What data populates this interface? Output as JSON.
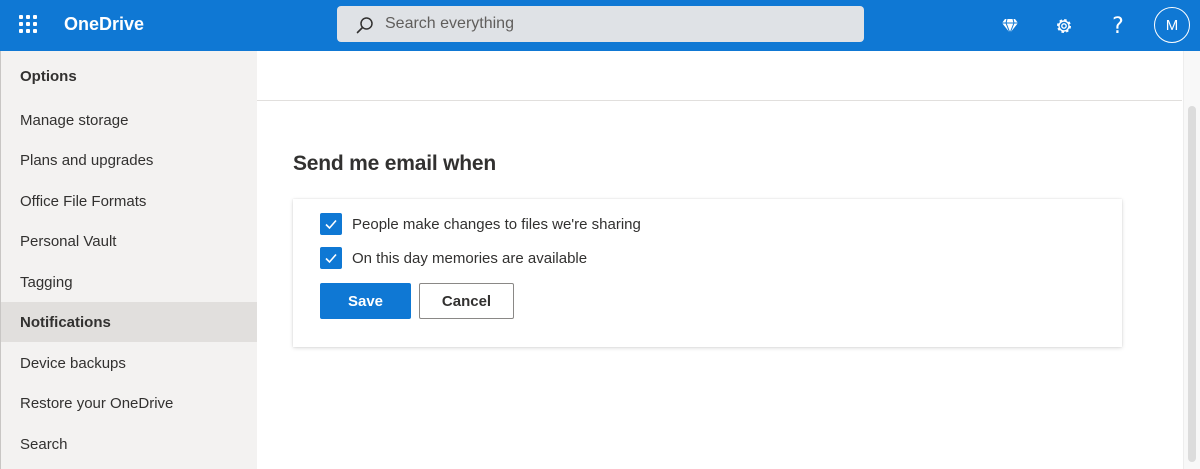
{
  "header": {
    "app_name": "OneDrive",
    "search_placeholder": "Search everything",
    "help_glyph": "?",
    "avatar_initial": "M",
    "brand_color": "#0f78d4",
    "icons": [
      "app-launcher-icon",
      "search-icon",
      "premium-diamond-icon",
      "settings-gear-icon",
      "help-icon"
    ]
  },
  "sidebar": {
    "heading": "Options",
    "items": [
      {
        "label": "Manage storage",
        "active": false
      },
      {
        "label": "Plans and upgrades",
        "active": false
      },
      {
        "label": "Office File Formats",
        "active": false
      },
      {
        "label": "Personal Vault",
        "active": false
      },
      {
        "label": "Tagging",
        "active": false
      },
      {
        "label": "Notifications",
        "active": true
      },
      {
        "label": "Device backups",
        "active": false
      },
      {
        "label": "Restore your OneDrive",
        "active": false
      },
      {
        "label": "Search",
        "active": false
      }
    ]
  },
  "main": {
    "section_title": "Send me email when",
    "options": [
      {
        "label": "People make changes to files we're sharing",
        "checked": true
      },
      {
        "label": "On this day memories are available",
        "checked": true
      }
    ],
    "save_label": "Save",
    "cancel_label": "Cancel"
  }
}
